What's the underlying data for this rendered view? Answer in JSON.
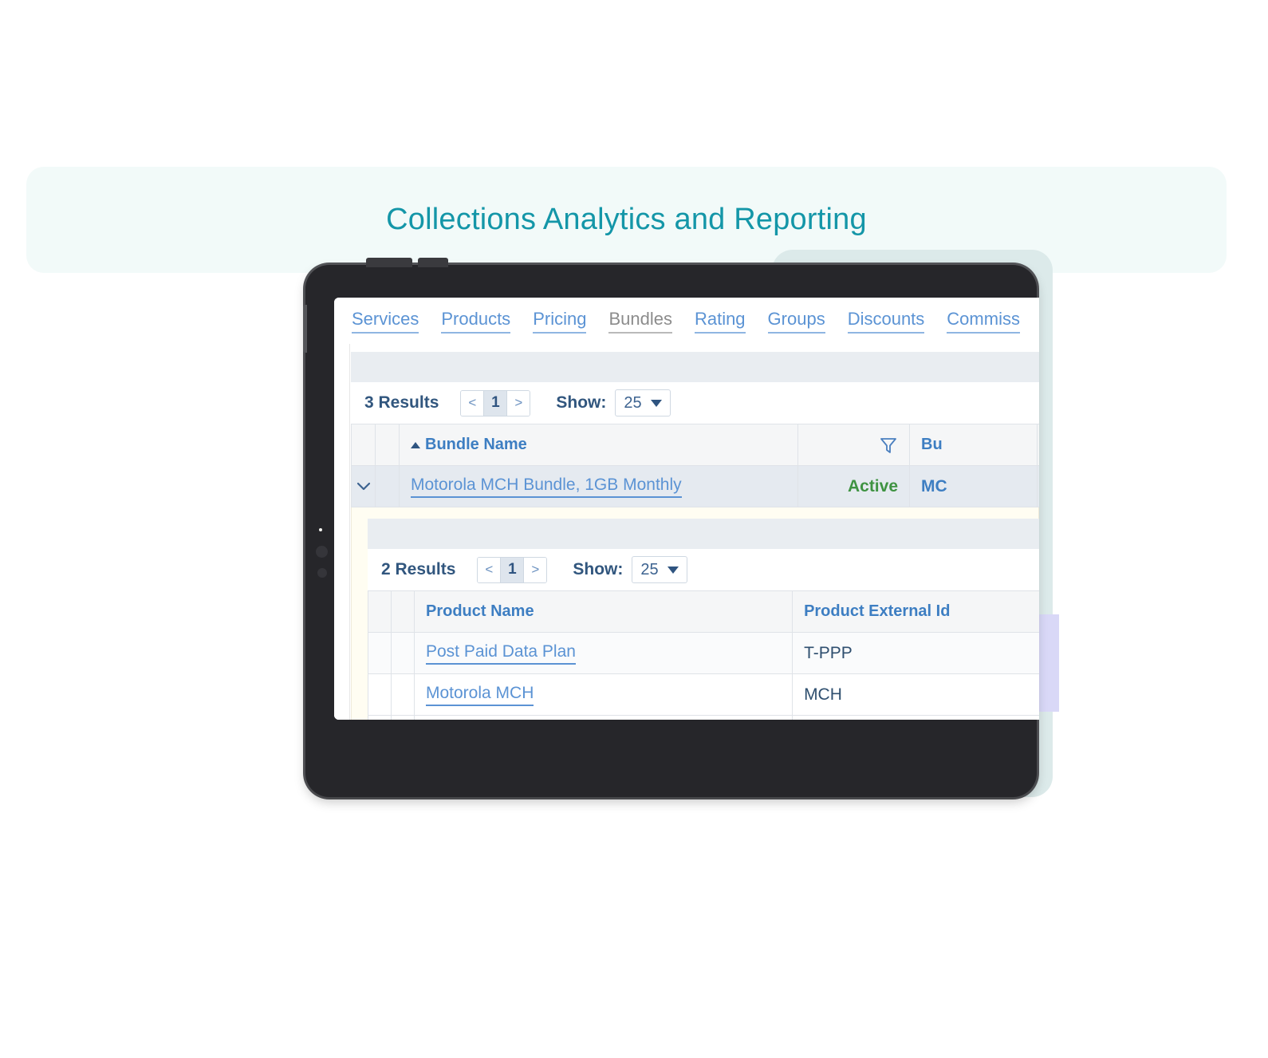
{
  "page": {
    "title": "Collections Analytics and Reporting"
  },
  "colors": {
    "banner_bg": "#f2faf9",
    "title_teal": "#1496a8",
    "link_blue": "#5b93d4",
    "header_blue": "#3d7ec2",
    "status_green": "#3f9342",
    "deco_teal": "#dceaea",
    "deco_lavender": "#d9d8f7",
    "band_gray": "#e9edf1",
    "detail_cream": "#fffdf2",
    "tablet_body": "#26262a"
  },
  "app": {
    "nav_tabs": [
      {
        "label": "Services",
        "active": false
      },
      {
        "label": "Products",
        "active": false
      },
      {
        "label": "Pricing",
        "active": false
      },
      {
        "label": "Bundles",
        "active": true
      },
      {
        "label": "Rating",
        "active": false
      },
      {
        "label": "Groups",
        "active": false
      },
      {
        "label": "Discounts",
        "active": false
      },
      {
        "label": "Commiss",
        "active": false
      }
    ],
    "bundles_grid": {
      "results_label": "3 Results",
      "pager": {
        "prev": "<",
        "page": "1",
        "next": ">"
      },
      "show_label": "Show:",
      "show_value": "25",
      "sort_indicator": "ascending",
      "columns": [
        {
          "label": "Bundle Name"
        },
        {
          "label": "Bu"
        }
      ],
      "rows": [
        {
          "expander": "⌄",
          "bundle_name": "Motorola MCH Bundle, 1GB Monthly",
          "status": "Active",
          "bundle_external_id": "MC"
        }
      ]
    },
    "products_grid": {
      "results_label": "2 Results",
      "pager": {
        "prev": "<",
        "page": "1",
        "next": ">"
      },
      "show_label": "Show:",
      "show_value": "25",
      "columns": [
        {
          "label": "Product Name"
        },
        {
          "label": "Product External Id"
        }
      ],
      "rows": [
        {
          "product_name": "Post Paid Data Plan",
          "product_external_id": "T-PPP"
        },
        {
          "product_name": "Motorola MCH",
          "product_external_id": "MCH"
        }
      ]
    }
  },
  "icons": {
    "filter": "filter-funnel-icon",
    "sort_asc": "sort-ascending-icon",
    "chevron_down": "chevron-down-icon",
    "caret_down": "caret-down-icon"
  }
}
